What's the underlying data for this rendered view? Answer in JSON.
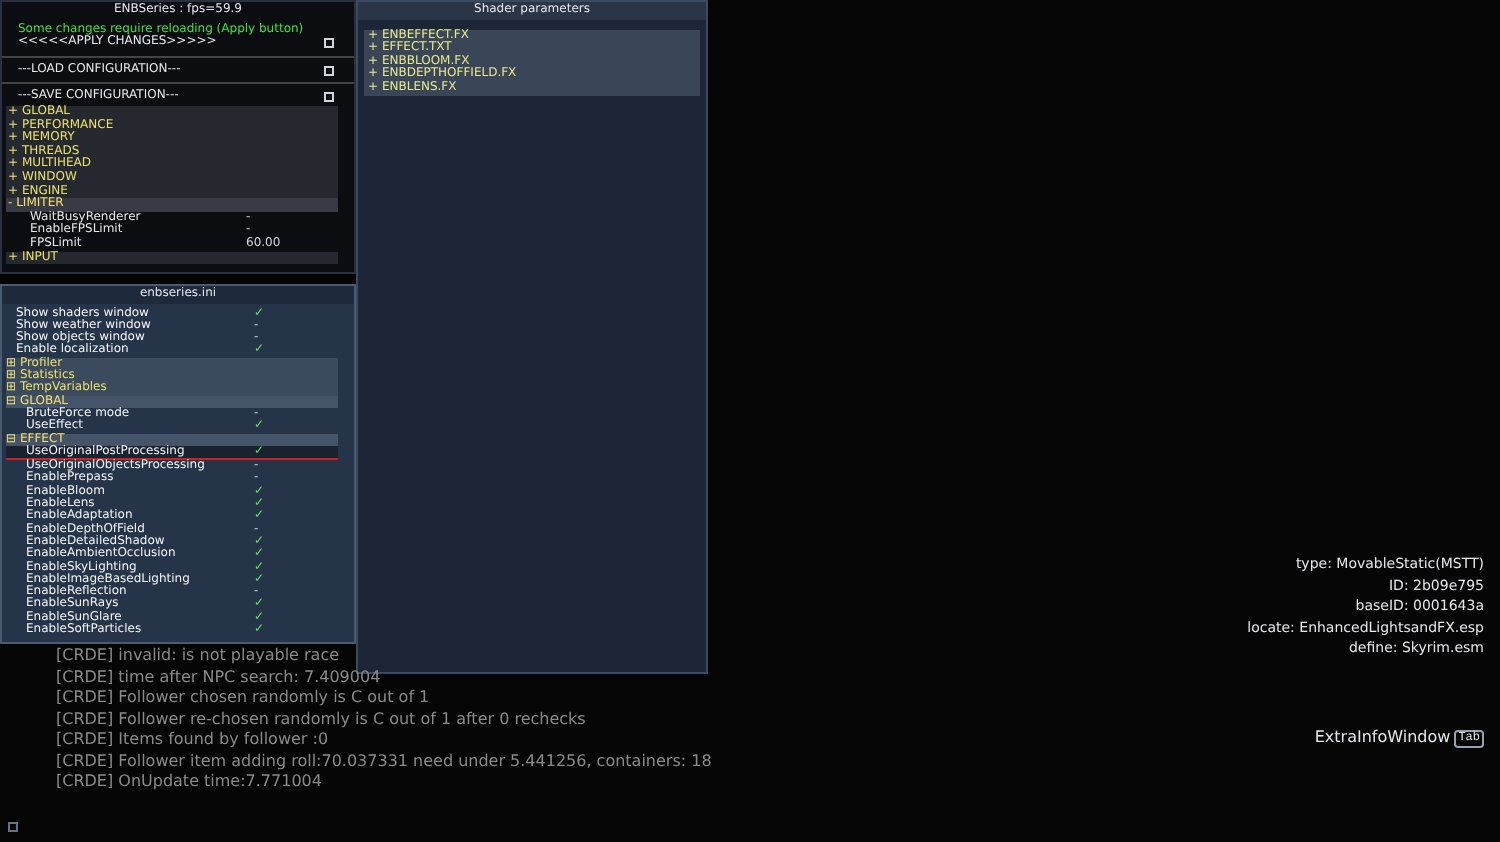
{
  "main_window": {
    "title": "ENBSeries : fps=59.9",
    "notice": "Some changes require reloading (Apply button)",
    "actions": [
      {
        "label": "<<<<<APPLY CHANGES>>>>>",
        "checked": false
      },
      {
        "label": "---LOAD CONFIGURATION---",
        "checked": false
      },
      {
        "label": "---SAVE CONFIGURATION---",
        "checked": false
      }
    ],
    "groups": [
      {
        "sign": "+",
        "label": "GLOBAL",
        "expanded": false
      },
      {
        "sign": "+",
        "label": "PERFORMANCE",
        "expanded": false
      },
      {
        "sign": "+",
        "label": "MEMORY",
        "expanded": false
      },
      {
        "sign": "+",
        "label": "THREADS",
        "expanded": false
      },
      {
        "sign": "+",
        "label": "MULTIHEAD",
        "expanded": false
      },
      {
        "sign": "+",
        "label": "WINDOW",
        "expanded": false
      },
      {
        "sign": "+",
        "label": "ENGINE",
        "expanded": false
      },
      {
        "sign": "-",
        "label": "LIMITER",
        "expanded": true,
        "children": [
          {
            "name": "WaitBusyRenderer",
            "value": "-"
          },
          {
            "name": "EnableFPSLimit",
            "value": "-"
          },
          {
            "name": "FPSLimit",
            "value": "60.00"
          }
        ]
      },
      {
        "sign": "+",
        "label": "INPUT",
        "expanded": false
      }
    ]
  },
  "shader_window": {
    "title": "Shader parameters",
    "items": [
      {
        "sign": "+",
        "label": "ENBEFFECT.FX"
      },
      {
        "sign": "+",
        "label": "EFFECT.TXT"
      },
      {
        "sign": "+",
        "label": "ENBBLOOM.FX"
      },
      {
        "sign": "+",
        "label": "ENBDEPTHOFFIELD.FX"
      },
      {
        "sign": "+",
        "label": "ENBLENS.FX"
      }
    ]
  },
  "ini_window": {
    "title": "enbseries.ini",
    "settings": [
      {
        "name": "Show shaders window",
        "value": "✓"
      },
      {
        "name": "Show weather window",
        "value": "-"
      },
      {
        "name": "Show objects window",
        "value": "-"
      },
      {
        "name": "Enable localization",
        "value": "✓"
      }
    ],
    "groups": [
      {
        "sign": "⊞",
        "name": "Profiler",
        "expanded": false
      },
      {
        "sign": "⊞",
        "name": "Statistics",
        "expanded": false
      },
      {
        "sign": "⊞",
        "name": "TempVariables",
        "expanded": false
      },
      {
        "sign": "⊟",
        "name": "GLOBAL",
        "expanded": true,
        "children": [
          {
            "name": "BruteForce mode",
            "value": "-",
            "selected": false
          },
          {
            "name": "UseEffect",
            "value": "✓",
            "selected": false
          }
        ]
      },
      {
        "sign": "⊟",
        "name": "EFFECT",
        "expanded": true,
        "children": [
          {
            "name": "UseOriginalPostProcessing",
            "value": "✓",
            "selected": true
          },
          {
            "name": "UseOriginalObjectsProcessing",
            "value": "-",
            "selected": false
          },
          {
            "name": "EnablePrepass",
            "value": "-",
            "selected": false
          },
          {
            "name": "EnableBloom",
            "value": "✓",
            "selected": false
          },
          {
            "name": "EnableLens",
            "value": "✓",
            "selected": false
          },
          {
            "name": "EnableAdaptation",
            "value": "✓",
            "selected": false
          },
          {
            "name": "EnableDepthOfField",
            "value": "-",
            "selected": false
          },
          {
            "name": "EnableDetailedShadow",
            "value": "✓",
            "selected": false
          },
          {
            "name": "EnableAmbientOcclusion",
            "value": "✓",
            "selected": false
          },
          {
            "name": "EnableSkyLighting",
            "value": "✓",
            "selected": false
          },
          {
            "name": "EnableImageBasedLighting",
            "value": "✓",
            "selected": false
          },
          {
            "name": "EnableReflection",
            "value": "-",
            "selected": false
          },
          {
            "name": "EnableSunRays",
            "value": "✓",
            "selected": false
          },
          {
            "name": "EnableSunGlare",
            "value": "✓",
            "selected": false
          },
          {
            "name": "EnableSoftParticles",
            "value": "✓",
            "selected": false
          }
        ]
      }
    ]
  },
  "console": {
    "lines": [
      "[CRDE] invalid:  is not playable race",
      "[CRDE] time after NPC search: 7.409004",
      "[CRDE] Follower chosen randomly is C    out of 1",
      "[CRDE] Follower re-chosen randomly is C    out of 1 after 0 rechecks",
      "[CRDE] Items found by follower :0",
      "[CRDE] Follower item adding roll:70.037331 need under 5.441256, containers: 18",
      "[CRDE] OnUpdate time:7.771004"
    ]
  },
  "info": {
    "lines": [
      "type: MovableStatic(MSTT)",
      "ID: 2b09e795",
      "baseID: 0001643a",
      "locate: EnhancedLightsandFX.esp",
      "define: Skyrim.esm"
    ],
    "extra_label": "ExtraInfoWindow",
    "key": "Tab"
  }
}
